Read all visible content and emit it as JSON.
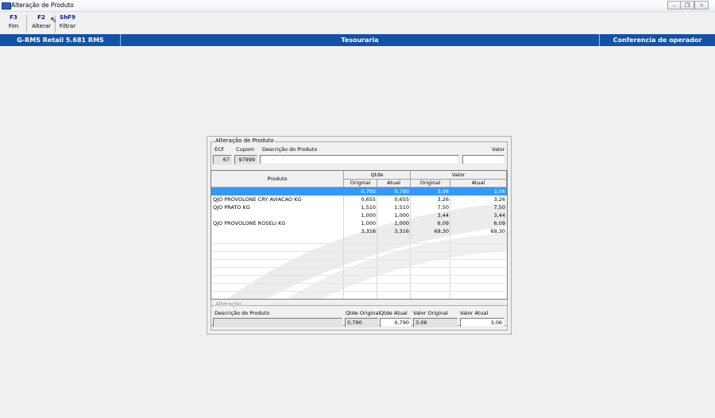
{
  "window": {
    "title": "Alteração de Produto",
    "buttons": [
      "minimize",
      "restore",
      "close"
    ]
  },
  "toolbar": [
    {
      "key": "F3",
      "label": "Fim"
    },
    {
      "key": "F2",
      "label": "Alterar"
    },
    {
      "key": "ShF9",
      "label": "Filtrar"
    }
  ],
  "header_bar": {
    "left": "G-RMS Retail 5.681 RMS",
    "center": "Tesouraria",
    "right": "Conferencia de operador"
  },
  "panel": {
    "group_title": "Alteração de Produto",
    "ecf_label": "ECF",
    "cupom_label": "Cupom",
    "descricao_label": "Descrição do Produto",
    "valor_label": "Valor",
    "ecf_value": "67",
    "cupom_value": "97999",
    "descricao_value": "",
    "valor_value": ""
  },
  "grid": {
    "header_produto": "Produto",
    "header_qtde": "Qtde",
    "header_valor": "Valor",
    "sub_original_qtde": "Original",
    "sub_atual_qtde": "Atual",
    "sub_original_valor": "Original",
    "sub_atual_valor": "Atual",
    "rows": [
      {
        "produto": "",
        "qtde_original": "0,790",
        "qtde_atual": "0,790",
        "valor_original": "3,06",
        "valor_atual": "3,06",
        "selected": true
      },
      {
        "produto": "QJO PROVOLONE CRY AVIACAO KG",
        "qtde_original": "0,655",
        "qtde_atual": "0,655",
        "valor_original": "3,26",
        "valor_atual": "3,26"
      },
      {
        "produto": "QJO PRATO KG",
        "qtde_original": "1,510",
        "qtde_atual": "1,510",
        "valor_original": "7,50",
        "valor_atual": "7,50"
      },
      {
        "produto": "",
        "qtde_original": "1,000",
        "qtde_atual": "1,000",
        "valor_original": "3,44",
        "valor_atual": "3,44"
      },
      {
        "produto": "QJO PROVOLONE ROSELI KG",
        "qtde_original": "1,000",
        "qtde_atual": "1,000",
        "valor_original": "6,09",
        "valor_atual": "6,09"
      },
      {
        "produto": "",
        "qtde_original": "3,316",
        "qtde_atual": "3,316",
        "valor_original": "69,30",
        "valor_atual": "69,30"
      }
    ]
  },
  "alteracao": {
    "group_title": "Alteração",
    "descricao_label": "Descrição do Produto",
    "qtde_original_label": "Qtde Original",
    "qtde_atual_label": "Qtde Atual",
    "valor_original_label": "Valor Original",
    "valor_atual_label": "Valor Atual",
    "descricao_value": "",
    "qtde_original_value": "0,790",
    "qtde_atual_value": "0,790",
    "valor_original_value": "3,06",
    "valor_atual_value": "3,06"
  }
}
